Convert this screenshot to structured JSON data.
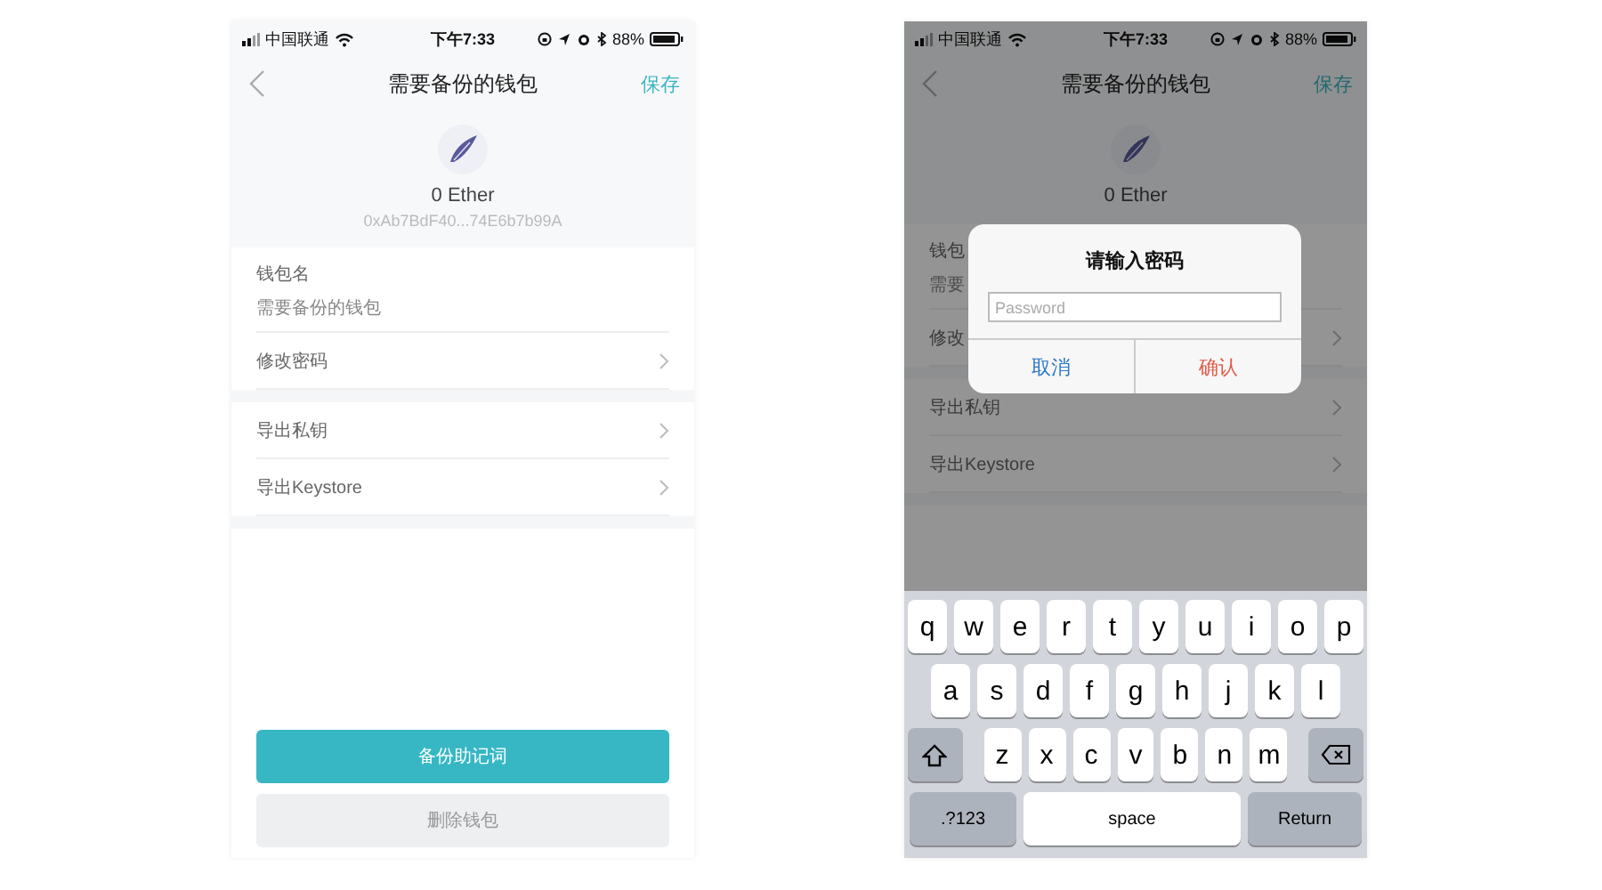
{
  "screens": [
    {
      "status_bar": {
        "carrier": "中国联通",
        "time": "下午7:33",
        "battery": "88%"
      },
      "nav": {
        "title": "需要备份的钱包",
        "action": "保存"
      },
      "wallet": {
        "balance": "0 Ether",
        "address": "0xAb7BdF40...74E6b7b99A"
      },
      "sections": [
        {
          "rows": [
            {
              "kind": "field",
              "label": "钱包名",
              "value": "需要备份的钱包"
            },
            {
              "kind": "link",
              "label": "修改密码"
            }
          ]
        },
        {
          "rows": [
            {
              "kind": "link",
              "label": "导出私钥"
            },
            {
              "kind": "link",
              "label": "导出Keystore"
            }
          ]
        }
      ],
      "buttons": [
        {
          "kind": "primary",
          "label": "备份助记词"
        },
        {
          "kind": "secondary",
          "label": "删除钱包"
        }
      ]
    },
    {
      "status_bar": {
        "carrier": "中国联通",
        "time": "下午7:33",
        "battery": "88%"
      },
      "nav": {
        "title": "需要备份的钱包",
        "action": "保存"
      },
      "wallet": {
        "balance": "0 Ether"
      },
      "sections": [
        {
          "rows": [
            {
              "kind": "field",
              "label": "钱包",
              "value": "需要"
            },
            {
              "kind": "link",
              "label": "修改"
            }
          ]
        },
        {
          "rows": [
            {
              "kind": "link",
              "label": "导出私钥"
            },
            {
              "kind": "link",
              "label": "导出Keystore"
            }
          ]
        }
      ],
      "dialog": {
        "title": "请输入密码",
        "placeholder": "Password",
        "cancel": "取消",
        "confirm": "确认"
      },
      "keyboard": {
        "rows": [
          {
            "keys": [
              "q",
              "w",
              "e",
              "r",
              "t",
              "y",
              "u",
              "i",
              "o",
              "p"
            ]
          },
          {
            "keys": [
              "a",
              "s",
              "d",
              "f",
              "g",
              "h",
              "j",
              "k",
              "l"
            ]
          },
          {
            "keys": [
              {
                "kind": "shift"
              },
              "z",
              "x",
              "c",
              "v",
              "b",
              "n",
              "m",
              {
                "kind": "delete"
              }
            ]
          }
        ],
        "bottom_row": {
          "mode": ".?123",
          "space": "space",
          "return": "Return"
        }
      }
    }
  ]
}
